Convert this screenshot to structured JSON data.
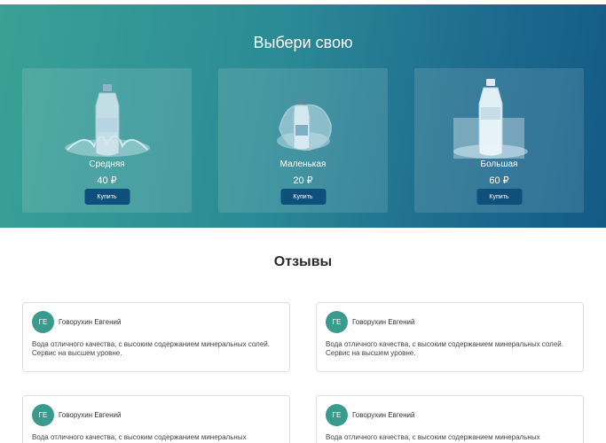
{
  "hero": {
    "title": "Выбери свою"
  },
  "products": [
    {
      "name": "Средняя",
      "price": "40 ₽",
      "buy_label": "Купить"
    },
    {
      "name": "Маленькая",
      "price": "20 ₽",
      "buy_label": "Купить"
    },
    {
      "name": "Большая",
      "price": "60 ₽",
      "buy_label": "Купить"
    }
  ],
  "reviews": {
    "title": "Отзывы",
    "items": [
      {
        "initials": "ГЕ",
        "author": "Говорухин Евгений",
        "text": "Вода отличного качества, с высоким содержанием минеральных солей. Сервис на высшем уровне."
      },
      {
        "initials": "ГЕ",
        "author": "Говорухин Евгений",
        "text": "Вода отличного качества, с высоким содержанием минеральных солей. Сервис на высшем уровне."
      },
      {
        "initials": "ГЕ",
        "author": "Говорухин Евгений",
        "text": "Вода отличного качества, с высоким содержанием минеральных"
      },
      {
        "initials": "ГЕ",
        "author": "Говорухин Евгений",
        "text": "Вода отличного качества, с высоким содержанием минеральных"
      }
    ]
  },
  "colors": {
    "hero_start": "#3aa196",
    "hero_end": "#135a86",
    "button": "#0e4f7c",
    "avatar": "#3a9a8c"
  }
}
